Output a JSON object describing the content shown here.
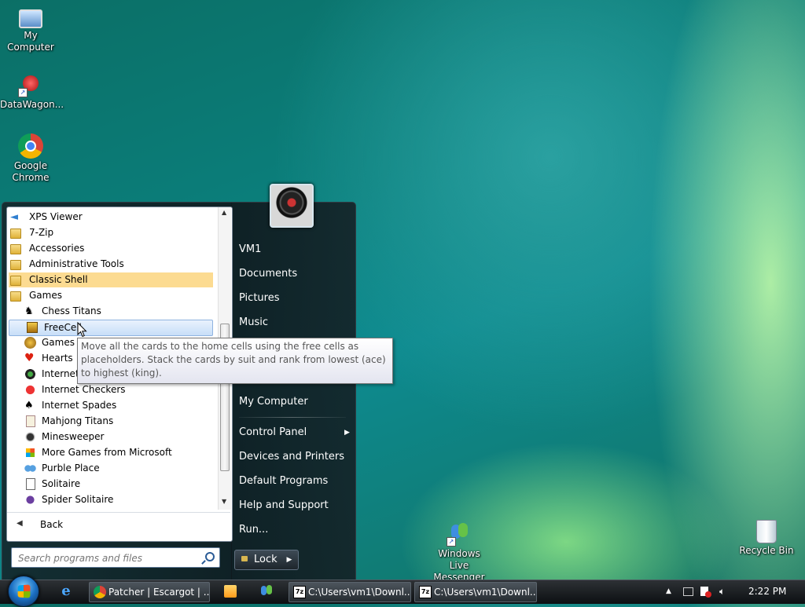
{
  "desktop": {
    "icons": [
      {
        "label": "My Computer",
        "icon": "computer-icon"
      },
      {
        "label": "DataWagon...",
        "icon": "datawagon-shortcut-icon"
      },
      {
        "label": "Google Chrome",
        "icon": "chrome-icon"
      },
      {
        "label": "Windows Live Messenger",
        "icon": "messenger-icon"
      },
      {
        "label": "Recycle Bin",
        "icon": "recycle-bin-icon"
      }
    ]
  },
  "start_menu": {
    "programs": [
      {
        "label": "XPS Viewer",
        "icon": "xps-viewer-icon",
        "type": "program"
      },
      {
        "label": "7-Zip",
        "icon": "folder-icon",
        "type": "folder"
      },
      {
        "label": "Accessories",
        "icon": "folder-icon",
        "type": "folder"
      },
      {
        "label": "Administrative Tools",
        "icon": "folder-icon",
        "type": "folder"
      },
      {
        "label": "Classic Shell",
        "icon": "folder-icon",
        "type": "folder",
        "highlighted": true
      },
      {
        "label": "Games",
        "icon": "folder-icon",
        "type": "folder",
        "expanded": true
      },
      {
        "label": "Chess Titans",
        "icon": "chess-icon",
        "type": "game"
      },
      {
        "label": "FreeCell",
        "icon": "freecell-icon",
        "type": "game",
        "selected": true
      },
      {
        "label": "Games",
        "icon": "games-explorer-icon",
        "type": "game"
      },
      {
        "label": "Hearts",
        "icon": "hearts-icon",
        "type": "game"
      },
      {
        "label": "Internet Backgammon",
        "icon": "backgammon-icon",
        "type": "game"
      },
      {
        "label": "Internet Checkers",
        "icon": "checkers-icon",
        "type": "game"
      },
      {
        "label": "Internet Spades",
        "icon": "spades-icon",
        "type": "game"
      },
      {
        "label": "Mahjong Titans",
        "icon": "mahjong-icon",
        "type": "game"
      },
      {
        "label": "Minesweeper",
        "icon": "minesweeper-icon",
        "type": "game"
      },
      {
        "label": "More Games from Microsoft",
        "icon": "more-games-icon",
        "type": "game"
      },
      {
        "label": "Purble Place",
        "icon": "purble-place-icon",
        "type": "game"
      },
      {
        "label": "Solitaire",
        "icon": "solitaire-icon",
        "type": "game"
      },
      {
        "label": "Spider Solitaire",
        "icon": "spider-solitaire-icon",
        "type": "game"
      }
    ],
    "back_label": "Back",
    "search_placeholder": "Search programs and files",
    "right_items": {
      "user": "VM1",
      "documents": "Documents",
      "pictures": "Pictures",
      "music": "Music",
      "my_computer": "My Computer",
      "control_panel": "Control Panel",
      "devices": "Devices and Printers",
      "default_programs": "Default Programs",
      "help": "Help and Support",
      "run": "Run..."
    },
    "lock_label": "Lock",
    "tooltip": "Move all the cards to the home cells using the free cells as placeholders. Stack the cards by suit and rank from lowest (ace) to highest (king)."
  },
  "taskbar": {
    "buttons": [
      {
        "label": "Patcher | Escargot | ...",
        "icon": "chrome-icon"
      },
      {
        "label": "C:\\Users\\vm1\\Downl...",
        "icon": "7zip-icon"
      },
      {
        "label": "C:\\Users\\vm1\\Downl...",
        "icon": "7zip-icon"
      }
    ],
    "clock": "2:22 PM"
  },
  "colors": {
    "folder_highlight": "#fcdb91",
    "selection": "#c7def8",
    "menu_dark": "#141e23"
  }
}
